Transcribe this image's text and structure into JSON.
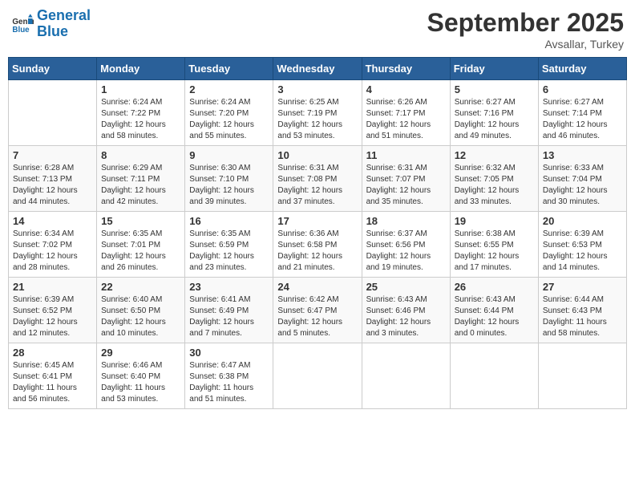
{
  "header": {
    "logo_line1": "General",
    "logo_line2": "Blue",
    "month_title": "September 2025",
    "location": "Avsallar, Turkey"
  },
  "days_of_week": [
    "Sunday",
    "Monday",
    "Tuesday",
    "Wednesday",
    "Thursday",
    "Friday",
    "Saturday"
  ],
  "weeks": [
    [
      {
        "day": "",
        "info": ""
      },
      {
        "day": "1",
        "info": "Sunrise: 6:24 AM\nSunset: 7:22 PM\nDaylight: 12 hours\nand 58 minutes."
      },
      {
        "day": "2",
        "info": "Sunrise: 6:24 AM\nSunset: 7:20 PM\nDaylight: 12 hours\nand 55 minutes."
      },
      {
        "day": "3",
        "info": "Sunrise: 6:25 AM\nSunset: 7:19 PM\nDaylight: 12 hours\nand 53 minutes."
      },
      {
        "day": "4",
        "info": "Sunrise: 6:26 AM\nSunset: 7:17 PM\nDaylight: 12 hours\nand 51 minutes."
      },
      {
        "day": "5",
        "info": "Sunrise: 6:27 AM\nSunset: 7:16 PM\nDaylight: 12 hours\nand 49 minutes."
      },
      {
        "day": "6",
        "info": "Sunrise: 6:27 AM\nSunset: 7:14 PM\nDaylight: 12 hours\nand 46 minutes."
      }
    ],
    [
      {
        "day": "7",
        "info": "Sunrise: 6:28 AM\nSunset: 7:13 PM\nDaylight: 12 hours\nand 44 minutes."
      },
      {
        "day": "8",
        "info": "Sunrise: 6:29 AM\nSunset: 7:11 PM\nDaylight: 12 hours\nand 42 minutes."
      },
      {
        "day": "9",
        "info": "Sunrise: 6:30 AM\nSunset: 7:10 PM\nDaylight: 12 hours\nand 39 minutes."
      },
      {
        "day": "10",
        "info": "Sunrise: 6:31 AM\nSunset: 7:08 PM\nDaylight: 12 hours\nand 37 minutes."
      },
      {
        "day": "11",
        "info": "Sunrise: 6:31 AM\nSunset: 7:07 PM\nDaylight: 12 hours\nand 35 minutes."
      },
      {
        "day": "12",
        "info": "Sunrise: 6:32 AM\nSunset: 7:05 PM\nDaylight: 12 hours\nand 33 minutes."
      },
      {
        "day": "13",
        "info": "Sunrise: 6:33 AM\nSunset: 7:04 PM\nDaylight: 12 hours\nand 30 minutes."
      }
    ],
    [
      {
        "day": "14",
        "info": "Sunrise: 6:34 AM\nSunset: 7:02 PM\nDaylight: 12 hours\nand 28 minutes."
      },
      {
        "day": "15",
        "info": "Sunrise: 6:35 AM\nSunset: 7:01 PM\nDaylight: 12 hours\nand 26 minutes."
      },
      {
        "day": "16",
        "info": "Sunrise: 6:35 AM\nSunset: 6:59 PM\nDaylight: 12 hours\nand 23 minutes."
      },
      {
        "day": "17",
        "info": "Sunrise: 6:36 AM\nSunset: 6:58 PM\nDaylight: 12 hours\nand 21 minutes."
      },
      {
        "day": "18",
        "info": "Sunrise: 6:37 AM\nSunset: 6:56 PM\nDaylight: 12 hours\nand 19 minutes."
      },
      {
        "day": "19",
        "info": "Sunrise: 6:38 AM\nSunset: 6:55 PM\nDaylight: 12 hours\nand 17 minutes."
      },
      {
        "day": "20",
        "info": "Sunrise: 6:39 AM\nSunset: 6:53 PM\nDaylight: 12 hours\nand 14 minutes."
      }
    ],
    [
      {
        "day": "21",
        "info": "Sunrise: 6:39 AM\nSunset: 6:52 PM\nDaylight: 12 hours\nand 12 minutes."
      },
      {
        "day": "22",
        "info": "Sunrise: 6:40 AM\nSunset: 6:50 PM\nDaylight: 12 hours\nand 10 minutes."
      },
      {
        "day": "23",
        "info": "Sunrise: 6:41 AM\nSunset: 6:49 PM\nDaylight: 12 hours\nand 7 minutes."
      },
      {
        "day": "24",
        "info": "Sunrise: 6:42 AM\nSunset: 6:47 PM\nDaylight: 12 hours\nand 5 minutes."
      },
      {
        "day": "25",
        "info": "Sunrise: 6:43 AM\nSunset: 6:46 PM\nDaylight: 12 hours\nand 3 minutes."
      },
      {
        "day": "26",
        "info": "Sunrise: 6:43 AM\nSunset: 6:44 PM\nDaylight: 12 hours\nand 0 minutes."
      },
      {
        "day": "27",
        "info": "Sunrise: 6:44 AM\nSunset: 6:43 PM\nDaylight: 11 hours\nand 58 minutes."
      }
    ],
    [
      {
        "day": "28",
        "info": "Sunrise: 6:45 AM\nSunset: 6:41 PM\nDaylight: 11 hours\nand 56 minutes."
      },
      {
        "day": "29",
        "info": "Sunrise: 6:46 AM\nSunset: 6:40 PM\nDaylight: 11 hours\nand 53 minutes."
      },
      {
        "day": "30",
        "info": "Sunrise: 6:47 AM\nSunset: 6:38 PM\nDaylight: 11 hours\nand 51 minutes."
      },
      {
        "day": "",
        "info": ""
      },
      {
        "day": "",
        "info": ""
      },
      {
        "day": "",
        "info": ""
      },
      {
        "day": "",
        "info": ""
      }
    ]
  ]
}
